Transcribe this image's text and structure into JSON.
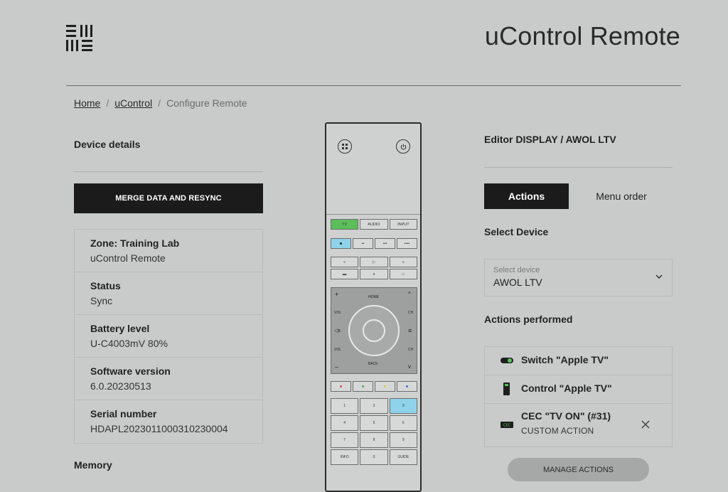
{
  "header": {
    "title": "uControl Remote",
    "logo_icon": "grid-logo-icon"
  },
  "breadcrumb": {
    "home": "Home",
    "parent": "uControl",
    "current": "Configure Remote",
    "separator": "/"
  },
  "left": {
    "device_details_title": "Device details",
    "merge_button": "MERGE DATA AND RESYNC",
    "details": [
      {
        "label": "Zone: Training Lab",
        "value": "uControl Remote"
      },
      {
        "label": "Status",
        "value": "Sync"
      },
      {
        "label": "Battery level",
        "value": "U-C4003mV 80%"
      },
      {
        "label": "Software version",
        "value": "6.0.20230513"
      },
      {
        "label": "Serial number",
        "value": "HDAPL2023011000310230004"
      }
    ],
    "memory_title": "Memory"
  },
  "remote": {
    "source_buttons": [
      "TV",
      "AUDIO",
      "INPUT"
    ],
    "nav_labels": {
      "home": "HOME",
      "back": "BACK",
      "vol": "VOL",
      "ch": "CH"
    },
    "numpad": [
      "1",
      "2",
      "3",
      "4",
      "5",
      "6",
      "7",
      "8",
      "9",
      "INFO",
      "0",
      "GUIDE"
    ],
    "colors": {
      "tv_active": "#5cbf5a",
      "highlight": "#8fd3ea"
    }
  },
  "right": {
    "editor_title": "Editor DISPLAY / AWOL LTV",
    "tabs": {
      "actions": "Actions",
      "menu_order": "Menu order"
    },
    "select_device_title": "Select Device",
    "select": {
      "placeholder": "Select device",
      "value": "AWOL LTV"
    },
    "actions_performed_title": "Actions performed",
    "actions": [
      {
        "icon": "toggle-switch-icon",
        "text": "Switch \"Apple TV\""
      },
      {
        "icon": "remote-control-icon",
        "text": "Control \"Apple TV\""
      },
      {
        "icon": "cec-badge-icon",
        "text": "CEC \"TV ON\" (#31)",
        "sub": "CUSTOM ACTION"
      }
    ],
    "manage_button": "MANAGE ACTIONS"
  }
}
